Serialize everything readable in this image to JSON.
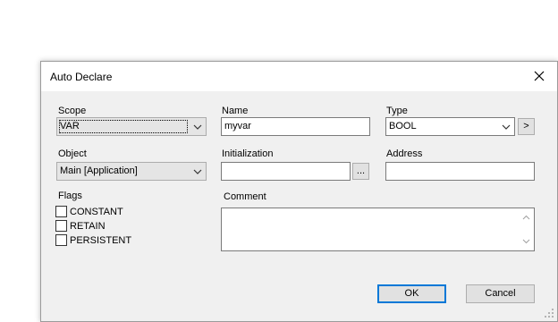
{
  "editor": {
    "variable_name": "myvar"
  },
  "dialog": {
    "title": "Auto Declare",
    "scope": {
      "label": "Scope",
      "value": "VAR"
    },
    "object": {
      "label": "Object",
      "value": "Main [Application]"
    },
    "flags": {
      "label": "Flags",
      "items": [
        {
          "label": "CONSTANT",
          "checked": false
        },
        {
          "label": "RETAIN",
          "checked": false
        },
        {
          "label": "PERSISTENT",
          "checked": false
        }
      ]
    },
    "name": {
      "label": "Name",
      "value": "myvar"
    },
    "initialization": {
      "label": "Initialization",
      "value": "",
      "browse_label": "..."
    },
    "comment": {
      "label": "Comment",
      "value": ""
    },
    "type": {
      "label": "Type",
      "value": "BOOL",
      "more_label": ">"
    },
    "address": {
      "label": "Address",
      "value": ""
    },
    "ok_label": "OK",
    "cancel_label": "Cancel"
  }
}
